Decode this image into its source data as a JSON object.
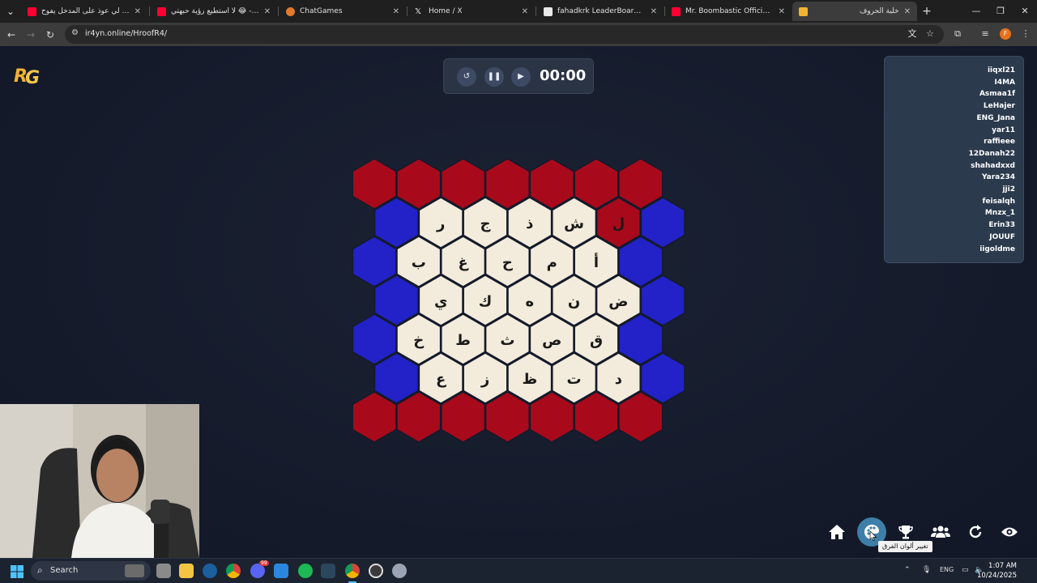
{
  "browser": {
    "tabs": [
      {
        "title": "حطيت لي عوذ على المدخل يفوح",
        "favicon_color": "#ff0033",
        "active": false
      },
      {
        "title": "لا استطيع رؤية حبهتي 😂 - YouTube",
        "favicon_color": "#ff0033",
        "active": false
      },
      {
        "title": "ChatGames",
        "favicon_color": "#e07a2f",
        "active": false
      },
      {
        "title": "Home / X",
        "favicon_color": "#ffffff",
        "active": false
      },
      {
        "title": "fahadkrk LeaderBoard | The be",
        "favicon_color": "#ffffff",
        "active": false
      },
      {
        "title": "Mr. Boombastic Official Music V",
        "favicon_color": "#ff0033",
        "active": false
      },
      {
        "title": "خلية الحروف",
        "favicon_color": "#f2b233",
        "active": true
      }
    ],
    "url": "ir4yn.online/HroofR4/",
    "profile_initial": "F"
  },
  "timer": {
    "time": "00:00",
    "icons": [
      "reset-icon",
      "pause-icon",
      "play-icon"
    ]
  },
  "players": [
    "iiqxl21",
    "I4MA",
    "Asmaa1f",
    "LeHajer",
    "ENG_Jana",
    "yar11",
    "raffieee",
    "12Danah22",
    "shahadxxd",
    "Yara234",
    "jji2",
    "feisalqh",
    "Mnzx_1",
    "Erin33",
    "JOUUF",
    "iigoldme"
  ],
  "board": {
    "colors": {
      "red": "#a80a1b",
      "blue": "#2222c8",
      "cream": "#f3ecdc"
    },
    "top_row": [
      "red",
      "red",
      "red",
      "red",
      "red",
      "red",
      "red"
    ],
    "bottom_row": [
      "red",
      "red",
      "red",
      "red",
      "red",
      "red",
      "red"
    ],
    "rows": [
      {
        "left": "blue",
        "cells": [
          "ر",
          "ج",
          "ذ",
          "ش",
          "ل"
        ],
        "red_cells": [
          4
        ],
        "right": "blue"
      },
      {
        "left": "blue",
        "cells": [
          "ب",
          "غ",
          "ح",
          "م",
          "أ"
        ],
        "red_cells": [],
        "right": "blue"
      },
      {
        "left": "blue",
        "cells": [
          "ي",
          "ك",
          "ه",
          "ن",
          "ض"
        ],
        "red_cells": [],
        "right": "blue"
      },
      {
        "left": "blue",
        "cells": [
          "خ",
          "ط",
          "ث",
          "ص",
          "ق"
        ],
        "red_cells": [],
        "right": "blue"
      },
      {
        "left": "blue",
        "cells": [
          "ع",
          "ز",
          "ظ",
          "ت",
          "د"
        ],
        "red_cells": [],
        "right": "blue"
      }
    ]
  },
  "controls": {
    "buttons": [
      "home-icon",
      "palette-icon",
      "trophy-icon",
      "team-icon",
      "refresh-icon",
      "eye-icon"
    ],
    "tooltip": "تغيير ألوان الفرق"
  },
  "taskbar": {
    "search_label": "Search",
    "lang": "ENG",
    "time": "1:07 AM",
    "date": "10/24/2025",
    "discord_badge": "99"
  }
}
